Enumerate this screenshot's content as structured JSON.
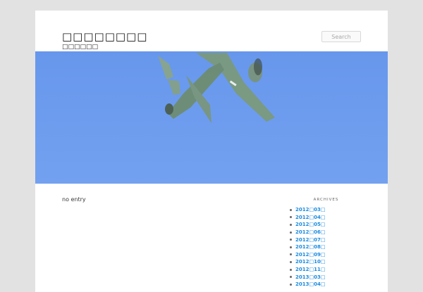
{
  "header": {
    "site_title": "□□□□□□□□",
    "site_description": "□□□□□□",
    "search_placeholder": "Search",
    "header_image_icon": "airplane-photo"
  },
  "main": {
    "content_text": "no entry"
  },
  "sidebar": {
    "widget_title": "ARCHIVES",
    "items": [
      {
        "label": "2012□03□"
      },
      {
        "label": "2012□04□"
      },
      {
        "label": "2012□05□"
      },
      {
        "label": "2012□06□"
      },
      {
        "label": "2012□07□"
      },
      {
        "label": "2012□08□"
      },
      {
        "label": "2012□09□"
      },
      {
        "label": "2012□10□"
      },
      {
        "label": "2012□11□"
      },
      {
        "label": "2013□03□"
      },
      {
        "label": "2013□04□"
      }
    ]
  },
  "colors": {
    "page_background": "#e2e2e2",
    "sky": "#6d9cee",
    "link": "#1b8be0"
  }
}
